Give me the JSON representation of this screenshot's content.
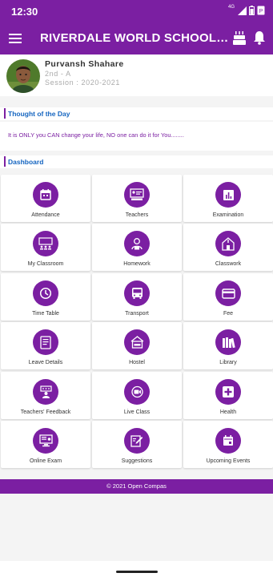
{
  "status_bar": {
    "time": "12:30",
    "network": "4G"
  },
  "app_bar": {
    "title": "RIVERDALE WORLD SCHOOL, GO..."
  },
  "profile": {
    "name": "Purvansh Shahare",
    "class": "2nd - A",
    "session": "Session : 2020-2021"
  },
  "thought": {
    "heading": "Thought of the Day",
    "text": "It is ONLY you CAN change your life, NO one can do it for You........"
  },
  "dashboard": {
    "heading": "Dashboard",
    "tiles": [
      {
        "label": "Attendance",
        "icon": "calendar-icon"
      },
      {
        "label": "Teachers",
        "icon": "teacher-board-icon"
      },
      {
        "label": "Examination",
        "icon": "bar-chart-icon"
      },
      {
        "label": "My Classroom",
        "icon": "classroom-icon"
      },
      {
        "label": "Homework",
        "icon": "student-reading-icon"
      },
      {
        "label": "Classwork",
        "icon": "school-building-icon"
      },
      {
        "label": "Time Table",
        "icon": "clock-icon"
      },
      {
        "label": "Transport",
        "icon": "bus-icon"
      },
      {
        "label": "Fee",
        "icon": "credit-card-icon"
      },
      {
        "label": "Leave Details",
        "icon": "document-icon"
      },
      {
        "label": "Hostel",
        "icon": "hostel-icon"
      },
      {
        "label": "Library",
        "icon": "books-icon"
      },
      {
        "label": "Teachers' Feedback",
        "icon": "feedback-icon"
      },
      {
        "label": "Live Class",
        "icon": "video-chat-icon"
      },
      {
        "label": "Health",
        "icon": "medical-kit-icon"
      },
      {
        "label": "Online Exam",
        "icon": "computer-exam-icon"
      },
      {
        "label": "Suggestions",
        "icon": "edit-note-icon"
      },
      {
        "label": "Upcoming Events",
        "icon": "event-calendar-icon"
      }
    ]
  },
  "footer": {
    "text": "© 2021 Open Compas"
  },
  "colors": {
    "primary": "#7b1fa2",
    "heading_blue": "#1565c0"
  }
}
